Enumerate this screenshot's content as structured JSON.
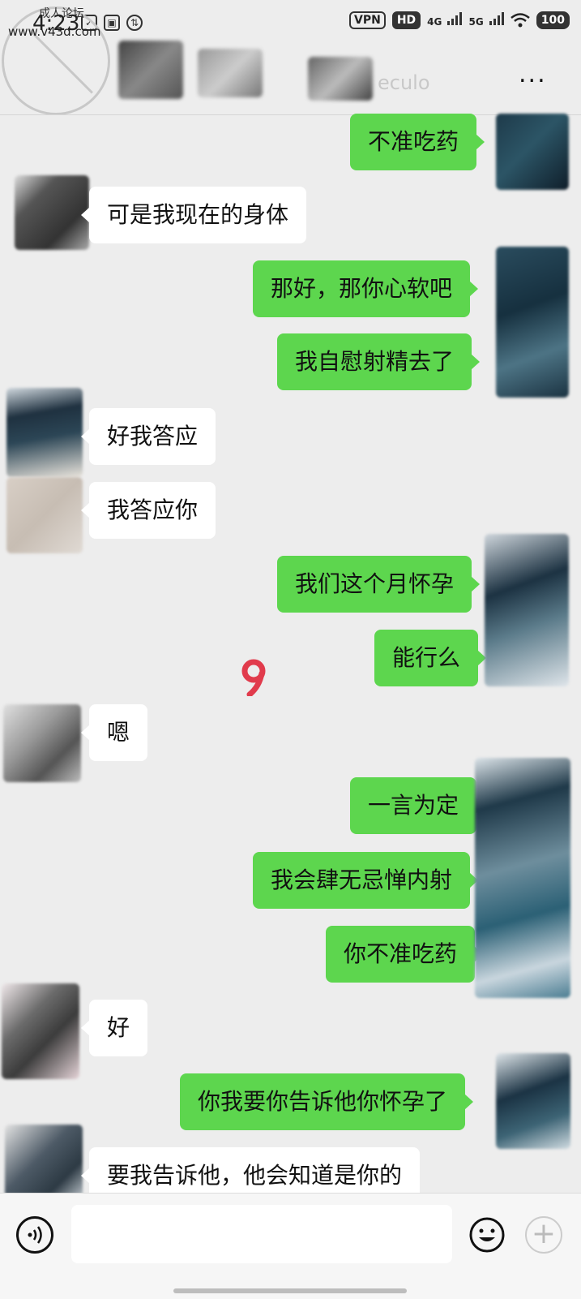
{
  "status_bar": {
    "time": "4:23",
    "vpn": "VPN",
    "hd": "HD",
    "net1": "4G",
    "net2": "5G",
    "battery": "100"
  },
  "watermark": {
    "top_text": "成人论坛",
    "site": "www.v43d.com"
  },
  "header": {
    "contact_name_fragment": "eculo",
    "more": "..."
  },
  "messages": [
    {
      "dir": "out",
      "text": "不准吃药"
    },
    {
      "dir": "in",
      "text": "可是我现在的身体"
    },
    {
      "dir": "out",
      "text": "那好，那你心软吧"
    },
    {
      "dir": "out",
      "text": "我自慰射精去了"
    },
    {
      "dir": "in",
      "text": "好我答应"
    },
    {
      "dir": "in",
      "text": "我答应你"
    },
    {
      "dir": "out",
      "text": "我们这个月怀孕"
    },
    {
      "dir": "out",
      "text": "能行么"
    },
    {
      "dir": "in",
      "text": "嗯"
    },
    {
      "dir": "out",
      "text": "一言为定"
    },
    {
      "dir": "out",
      "text": "我会肆无忌惮内射"
    },
    {
      "dir": "out",
      "text": "你不准吃药"
    },
    {
      "dir": "in",
      "text": "好"
    },
    {
      "dir": "out",
      "text": "你我要你告诉他你怀孕了"
    },
    {
      "dir": "in",
      "text": "要我告诉他，他会知道是你的"
    }
  ],
  "input_bar": {
    "placeholder": ""
  },
  "colors": {
    "outgoing_bubble": "#5dd64e",
    "incoming_bubble": "#ffffff",
    "background": "#ededed"
  }
}
